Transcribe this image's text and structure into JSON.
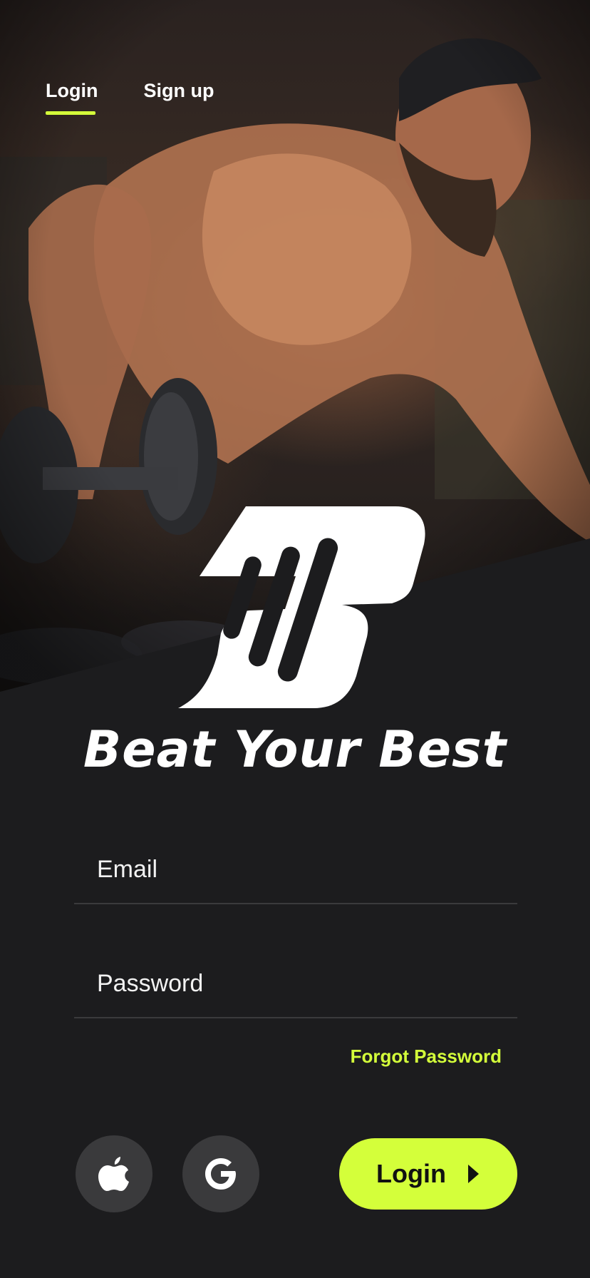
{
  "tabs": [
    {
      "label": "Login",
      "active": true
    },
    {
      "label": "Sign up",
      "active": false
    }
  ],
  "brand": {
    "tagline": "Beat Your Best"
  },
  "form": {
    "email_placeholder": "Email",
    "password_placeholder": "Password",
    "forgot_label": "Forgot Password"
  },
  "actions": {
    "apple_icon": "apple-icon",
    "google_icon": "google-icon",
    "login_label": "Login",
    "login_icon": "play-arrow-icon"
  },
  "colors": {
    "accent": "#d4ff3a",
    "background": "#1c1c1e",
    "social_button": "#3a3a3c"
  }
}
